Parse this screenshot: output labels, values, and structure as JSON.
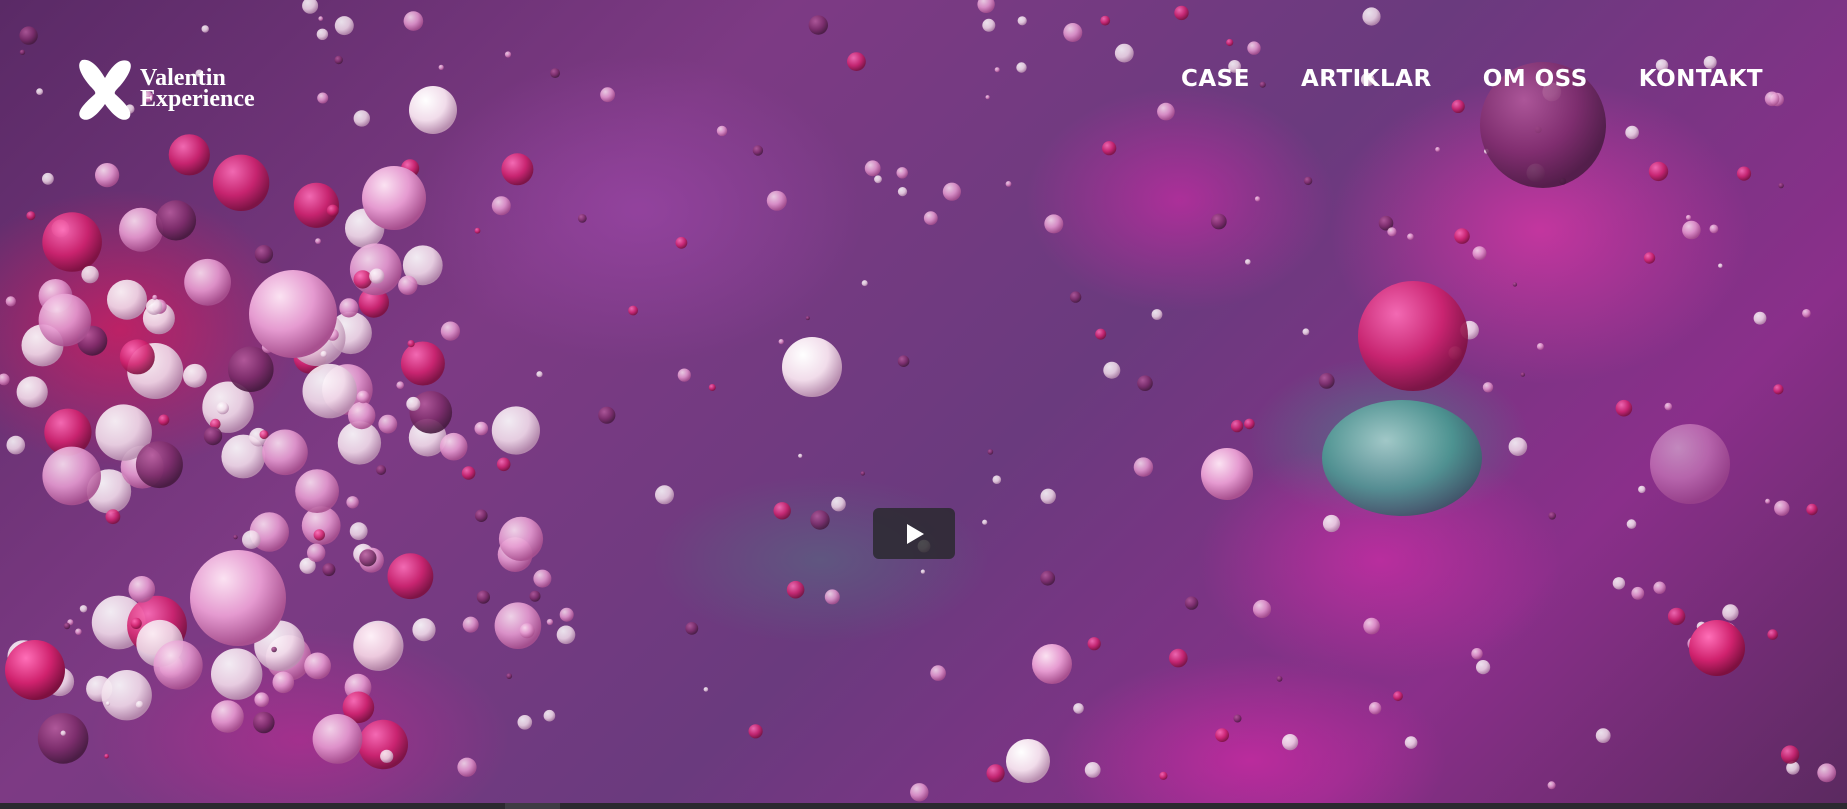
{
  "brand": {
    "name_line1": "Valentin",
    "name_line2": "Experience",
    "logo_icon": "x-logo-icon"
  },
  "nav": {
    "items": [
      {
        "label": "CASE"
      },
      {
        "label": "ARTIKLAR"
      },
      {
        "label": "OM OSS"
      },
      {
        "label": "KONTAKT"
      }
    ]
  },
  "video": {
    "play_icon": "play-icon",
    "progress_fraction": 0,
    "buffered_fraction": 0.03
  },
  "colors": {
    "text": "#ffffff",
    "accent_magenta": "#d02c9a",
    "background_purple": "#6a3a7e",
    "control_bg": "#28282c"
  }
}
